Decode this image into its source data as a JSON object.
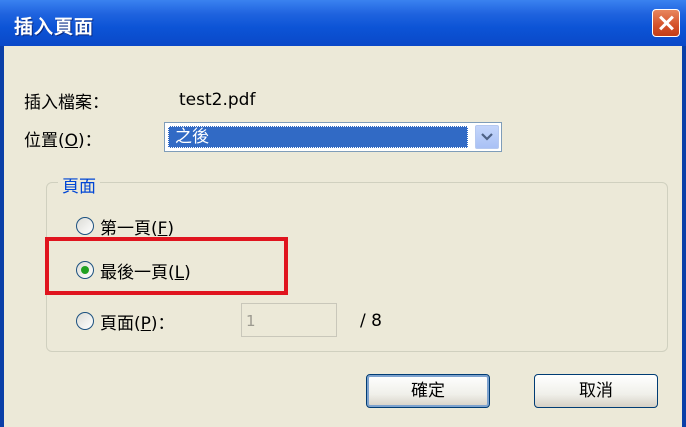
{
  "dialog": {
    "title": "插入頁面"
  },
  "insert_file": {
    "label": "插入檔案：",
    "value": "test2.pdf"
  },
  "position": {
    "label_prefix": "位置(",
    "label_key": "O",
    "label_suffix": ")：",
    "selected": "之後"
  },
  "pages_group": {
    "legend": "頁面",
    "options": [
      {
        "label": "第一頁(",
        "key": "F",
        "suffix": ")",
        "checked": false
      },
      {
        "label": "最後一頁(",
        "key": "L",
        "suffix": ")",
        "checked": true
      },
      {
        "label": "頁面(",
        "key": "P",
        "suffix": ")：",
        "checked": false
      }
    ],
    "page_input_value": "1",
    "total_pages": "/ 8"
  },
  "buttons": {
    "ok": "確定",
    "cancel": "取消"
  },
  "colors": {
    "highlight": "#e0141e",
    "title_bar": "#0c54d6"
  }
}
